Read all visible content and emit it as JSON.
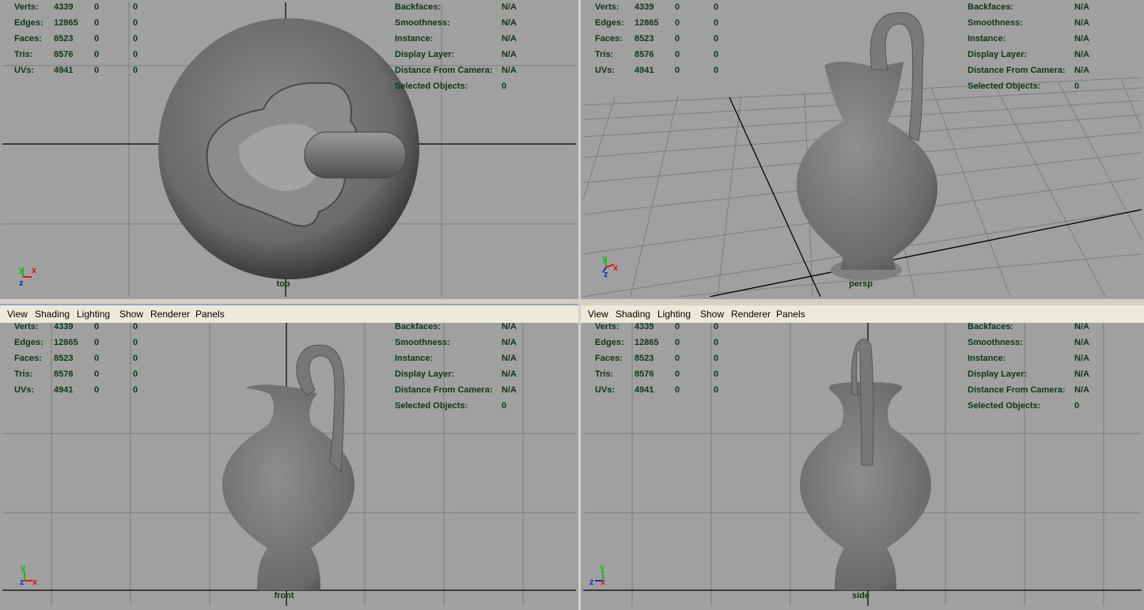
{
  "menu": [
    "View",
    "Shading",
    "Lighting",
    "Show",
    "Renderer",
    "Panels"
  ],
  "stats": [
    {
      "label": "Verts:",
      "v1": "4339",
      "v2": "0",
      "v3": "0"
    },
    {
      "label": "Edges:",
      "v1": "12865",
      "v2": "0",
      "v3": "0"
    },
    {
      "label": "Faces:",
      "v1": "8523",
      "v2": "0",
      "v3": "0"
    },
    {
      "label": "Tris:",
      "v1": "8576",
      "v2": "0",
      "v3": "0"
    },
    {
      "label": "UVs:",
      "v1": "4941",
      "v2": "0",
      "v3": "0"
    }
  ],
  "info": [
    {
      "label": "Backfaces:",
      "value": "N/A"
    },
    {
      "label": "Smoothness:",
      "value": "N/A"
    },
    {
      "label": "Instance:",
      "value": "N/A"
    },
    {
      "label": "Display Layer:",
      "value": "N/A"
    },
    {
      "label": "Distance From Camera:",
      "value": "N/A"
    },
    {
      "label": "Selected Objects:",
      "value": "0"
    }
  ],
  "panels": {
    "top": {
      "camera": "top",
      "axis": [
        "y",
        "x",
        "z"
      ]
    },
    "persp": {
      "camera": "persp",
      "axis": [
        "y",
        "x",
        "z"
      ]
    },
    "front": {
      "camera": "front",
      "axis": [
        "y",
        "z",
        "x"
      ]
    },
    "side": {
      "camera": "side",
      "axis": [
        "y",
        "z",
        "x"
      ]
    }
  },
  "colors": {
    "viewport": "#a0a0a0",
    "hud_text": "#0a3a12",
    "grid": "#7d7d7d",
    "axis_line": "#000000",
    "mesh": "#707070",
    "axis_x": "#e01010",
    "axis_y": "#10c010",
    "axis_z": "#1a2ad0"
  }
}
